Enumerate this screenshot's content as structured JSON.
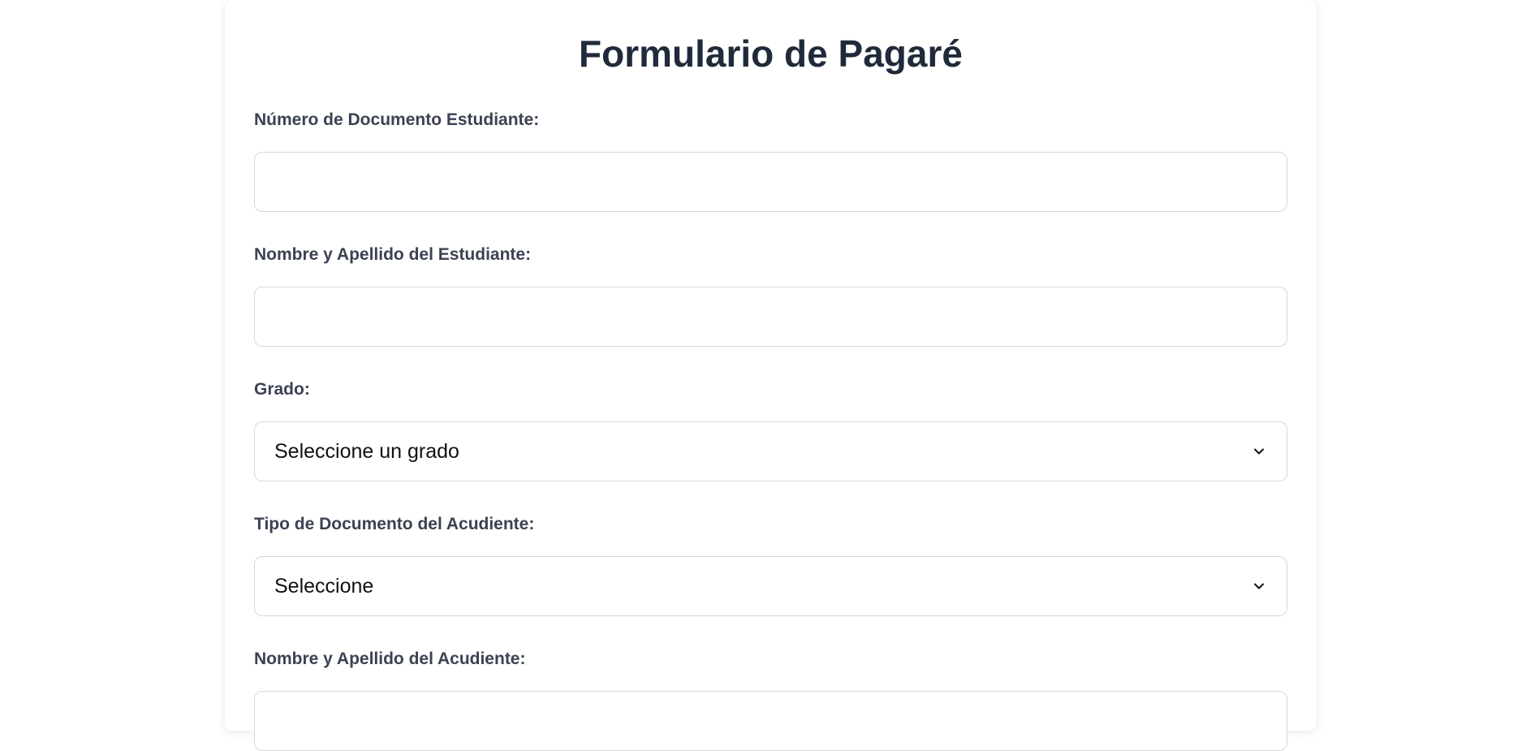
{
  "form": {
    "title": "Formulario de Pagaré",
    "fields": [
      {
        "label": "Número de Documento Estudiante:",
        "type": "text",
        "value": "",
        "placeholder": ""
      },
      {
        "label": "Nombre y Apellido del Estudiante:",
        "type": "text",
        "value": "",
        "placeholder": ""
      },
      {
        "label": "Grado:",
        "type": "select",
        "selected": "Seleccione un grado"
      },
      {
        "label": "Tipo de Documento del Acudiente:",
        "type": "select",
        "selected": "Seleccione"
      },
      {
        "label": "Nombre y Apellido del Acudiente:",
        "type": "text",
        "value": "",
        "placeholder": ""
      }
    ]
  },
  "icons": {
    "select_arrow": "chevron-down-icon"
  },
  "colors": {
    "title": "#1f2a3a",
    "label": "#3b4252",
    "border": "#d4d7dd"
  }
}
